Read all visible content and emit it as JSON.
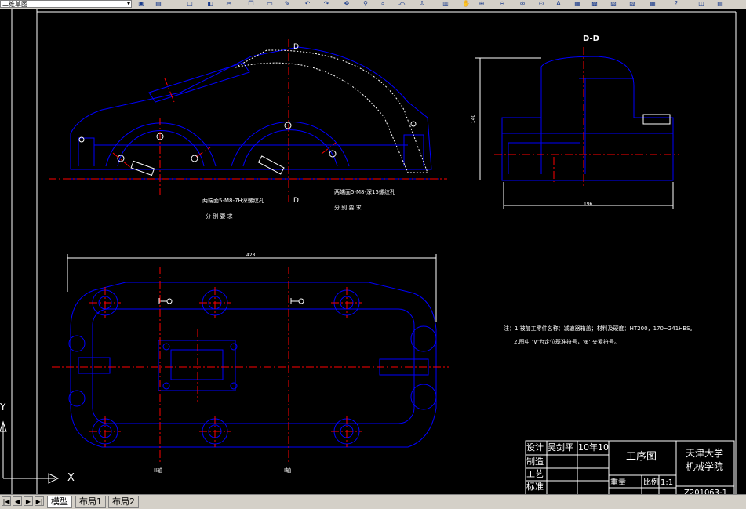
{
  "toolbar": {
    "workspace": "二维草图",
    "icons": [
      "save-icon",
      "print-icon",
      "cut-icon",
      "copy-icon",
      "paste-icon",
      "undo-icon",
      "redo-icon",
      "pan-icon",
      "zoom-realtime-icon",
      "zoom-window-icon",
      "zoom-previous-icon",
      "properties-icon",
      "design-center-icon",
      "tool-palette-icon",
      "sheet-set-icon",
      "markup-icon",
      "calculator-icon"
    ]
  },
  "drawing": {
    "section_label": "D-D",
    "cut_mark_top": "D",
    "cut_mark_bottom": "D",
    "dim_height": "140",
    "dim_width_side": "196",
    "dim_length": "428",
    "callout_left": "两端面5-M8-7H深螺纹孔",
    "callout_left_sub": "分 别 要 求",
    "callout_right": "两端面5-M8-深15螺纹孔",
    "callout_right_sub": "分 别 要 求",
    "axis_label_ii": "II轴",
    "axis_label_i": "I轴",
    "note_1": "注：1.被加工零件名称：减速器箱盖；材料及硬度：HT200，170~241HBS。",
    "note_2": "2.图中 '∨'为定位基准符号，'⊕' 夹紧符号。"
  },
  "title_block": {
    "row_design": "设计",
    "designer": "吴剑平",
    "date": "10年10",
    "row_make": "制造",
    "row_process": "工艺",
    "row_standard": "标准",
    "drawing_title": "工序图",
    "institution_line1": "天津大学",
    "institution_line2": "机械学院",
    "weight_label": "重量",
    "scale_label": "比例",
    "scale_value": "1:1",
    "drawing_number": "Z201063-1"
  },
  "ucs": {
    "x_label": "X",
    "y_label": "Y"
  },
  "tabs": {
    "model": "模型",
    "layout1": "布局1",
    "layout2": "布局2"
  },
  "colors": {
    "canvas": "#000000",
    "outline": "#0000ff",
    "centerline": "#ff0000",
    "text": "#ffffff",
    "hatch": "#ffffff"
  }
}
